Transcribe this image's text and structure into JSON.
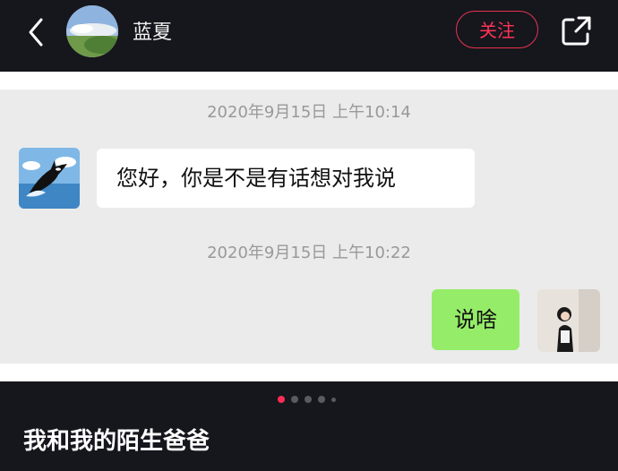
{
  "header": {
    "username": "蓝夏",
    "follow_label": "关注",
    "back_icon": "chevron-left-icon",
    "share_icon": "external-link-icon"
  },
  "chat": {
    "messages": [
      {
        "type": "timestamp",
        "text": "2020年9月15日 上午10:14"
      },
      {
        "type": "received",
        "text": "您好，你是不是有话想对我说"
      },
      {
        "type": "timestamp",
        "text": "2020年9月15日 上午10:22"
      },
      {
        "type": "sent",
        "text": "说啥"
      }
    ]
  },
  "footer": {
    "caption": "我和我的陌生爸爸",
    "carousel": {
      "total": 5,
      "active": 1
    }
  },
  "colors": {
    "accent_red": "#ff2d55",
    "sent_bubble": "#95ec69",
    "dark_bg": "#16161d"
  }
}
